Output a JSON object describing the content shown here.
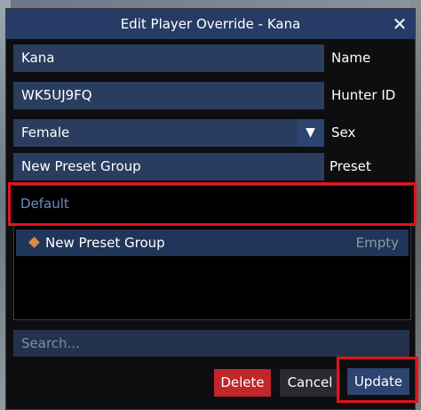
{
  "dialog": {
    "title": "Edit Player Override - Kana",
    "close_icon": "close-icon"
  },
  "fields": {
    "name": {
      "value": "Kana",
      "label": "Name"
    },
    "hunter_id": {
      "value": "WK5UJ9FQ",
      "label": "Hunter ID"
    },
    "sex": {
      "value": "Female",
      "label": "Sex",
      "dropdown_icon": "triangle-down-icon"
    },
    "preset_group": {
      "value": "New Preset Group",
      "label": "Preset Group"
    }
  },
  "list": {
    "header": "Default",
    "items": [
      {
        "name": "New Preset Group",
        "status": "Empty",
        "icon": "diamond-icon"
      }
    ]
  },
  "search": {
    "placeholder": "Search..."
  },
  "buttons": {
    "delete": "Delete",
    "cancel": "Cancel",
    "update": "Update"
  },
  "colors": {
    "title_bar": "#263c66",
    "field_bg": "#2a3d5e",
    "delete": "#c0262a",
    "update": "#2b4470",
    "highlight": "#e0141c",
    "diamond": "#d98c45"
  }
}
